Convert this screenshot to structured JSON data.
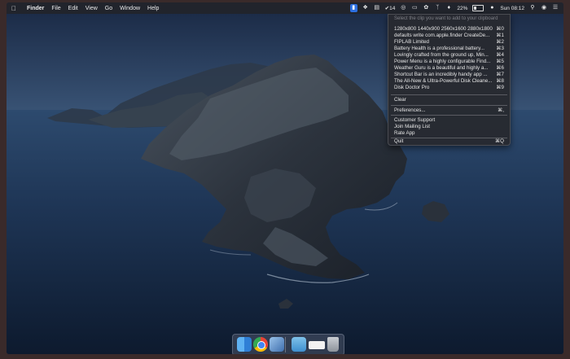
{
  "menubar": {
    "apple_icon": "apple-icon",
    "items": [
      "Finder",
      "File",
      "Edit",
      "View",
      "Go",
      "Window",
      "Help"
    ],
    "status": {
      "tasks_count": "14",
      "battery_percent": "22%",
      "battery_level": 0.22,
      "clock": "Sun 08:12"
    }
  },
  "clipboard_menu": {
    "hint": "Select the clip you want to add to your clipboard",
    "clips": [
      {
        "label": "1280x800 1440x900 2560x1600 2880x1800",
        "shortcut": "⌘0"
      },
      {
        "label": "defaults write com.apple.finder CreateDe...",
        "shortcut": "⌘1"
      },
      {
        "label": "FIPLAB Limited",
        "shortcut": "⌘2"
      },
      {
        "label": "Battery Health is a professional battery...",
        "shortcut": "⌘3"
      },
      {
        "label": "Lovingly crafted from the ground up, Min...",
        "shortcut": "⌘4"
      },
      {
        "label": "Power Menu is a highly configurable Find...",
        "shortcut": "⌘5"
      },
      {
        "label": "Weather Guru is a beautiful and highly a...",
        "shortcut": "⌘6"
      },
      {
        "label": "Shortcut Bar is an incredibly handy app ...",
        "shortcut": "⌘7"
      },
      {
        "label": "The All-New & Ultra-Powerful Disk Cleane...",
        "shortcut": "⌘8"
      },
      {
        "label": "Disk Doctor Pro",
        "shortcut": "⌘9"
      }
    ],
    "clear": "Clear",
    "preferences": {
      "label": "Preferences...",
      "shortcut": "⌘,"
    },
    "support": [
      "Customer Support",
      "Join Mailing List",
      "Rate App"
    ],
    "quit": {
      "label": "Quit",
      "shortcut": "⌘Q"
    }
  },
  "dock": {
    "apps": [
      "finder-icon",
      "chrome-icon",
      "preview-icon",
      "downloads-folder-icon",
      "document-stack-icon",
      "trash-icon"
    ]
  },
  "colors": {
    "clip_app_accent": "#2d6fe0",
    "ocean": "#1b2f4c",
    "land": "#2b3440"
  }
}
